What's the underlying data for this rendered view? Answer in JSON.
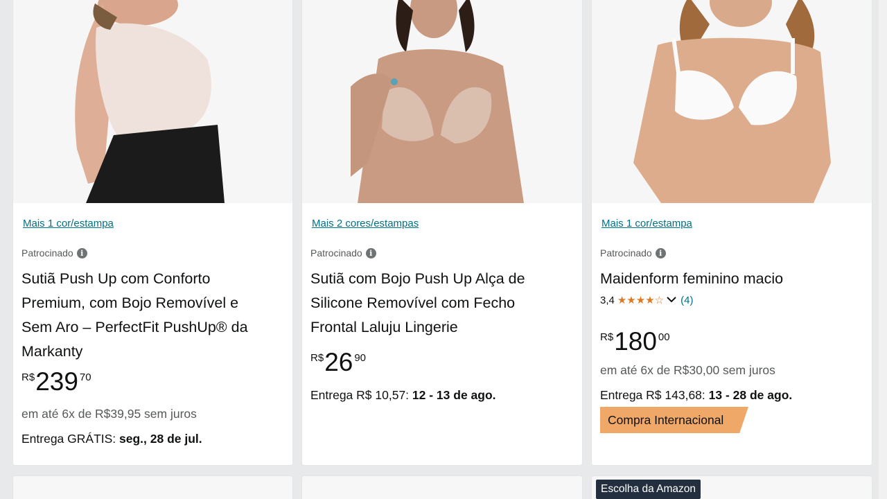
{
  "products": [
    {
      "swatch_link": "Mais 1 cor/estampa",
      "sponsored": "Patrocinado",
      "title_lines": [
        "Sutiã Push Up com Conforto",
        "Premium, com Bojo Removível e",
        "Sem Aro – PerfectFit PushUp® da",
        "Markanty"
      ],
      "price": {
        "symbol": "R$",
        "whole": "239",
        "fraction": "70"
      },
      "installments": "em até 6x de R$39,95 sem juros",
      "delivery_prefix": "Entrega GRÁTIS: ",
      "delivery_date": "seg., 28 de jul."
    },
    {
      "swatch_link": "Mais 2 cores/estampas",
      "sponsored": "Patrocinado",
      "title_lines": [
        "Sutiã com Bojo Push Up Alça de",
        "Silicone Removível com Fecho",
        "Frontal Laluju Lingerie"
      ],
      "price": {
        "symbol": "R$",
        "whole": "26",
        "fraction": "90"
      },
      "delivery_prefix": "Entrega R$ 10,57: ",
      "delivery_date": "12 - 13 de ago."
    },
    {
      "swatch_link": "Mais 1 cor/estampa",
      "sponsored": "Patrocinado",
      "title_lines": [
        "Maidenform feminino macio"
      ],
      "rating_value": "3,4",
      "rating_stars": "★★★★☆",
      "rating_count": "(4)",
      "price": {
        "symbol": "R$",
        "whole": "180",
        "fraction": "00"
      },
      "installments": "em até 6x de R$30,00 sem juros",
      "delivery_prefix": "Entrega R$ 143,68: ",
      "delivery_date": "13 - 28 de ago.",
      "badge": "Compra Internacional"
    }
  ],
  "next_row": {
    "choice_badge": "Escolha da Amazon"
  },
  "icons": {
    "info": "info-icon",
    "chevron": "chevron-down-icon"
  },
  "colors": {
    "link": "#007185",
    "star": "#de7921",
    "badge_international": "#f0a868",
    "badge_choice": "#232f3e"
  }
}
